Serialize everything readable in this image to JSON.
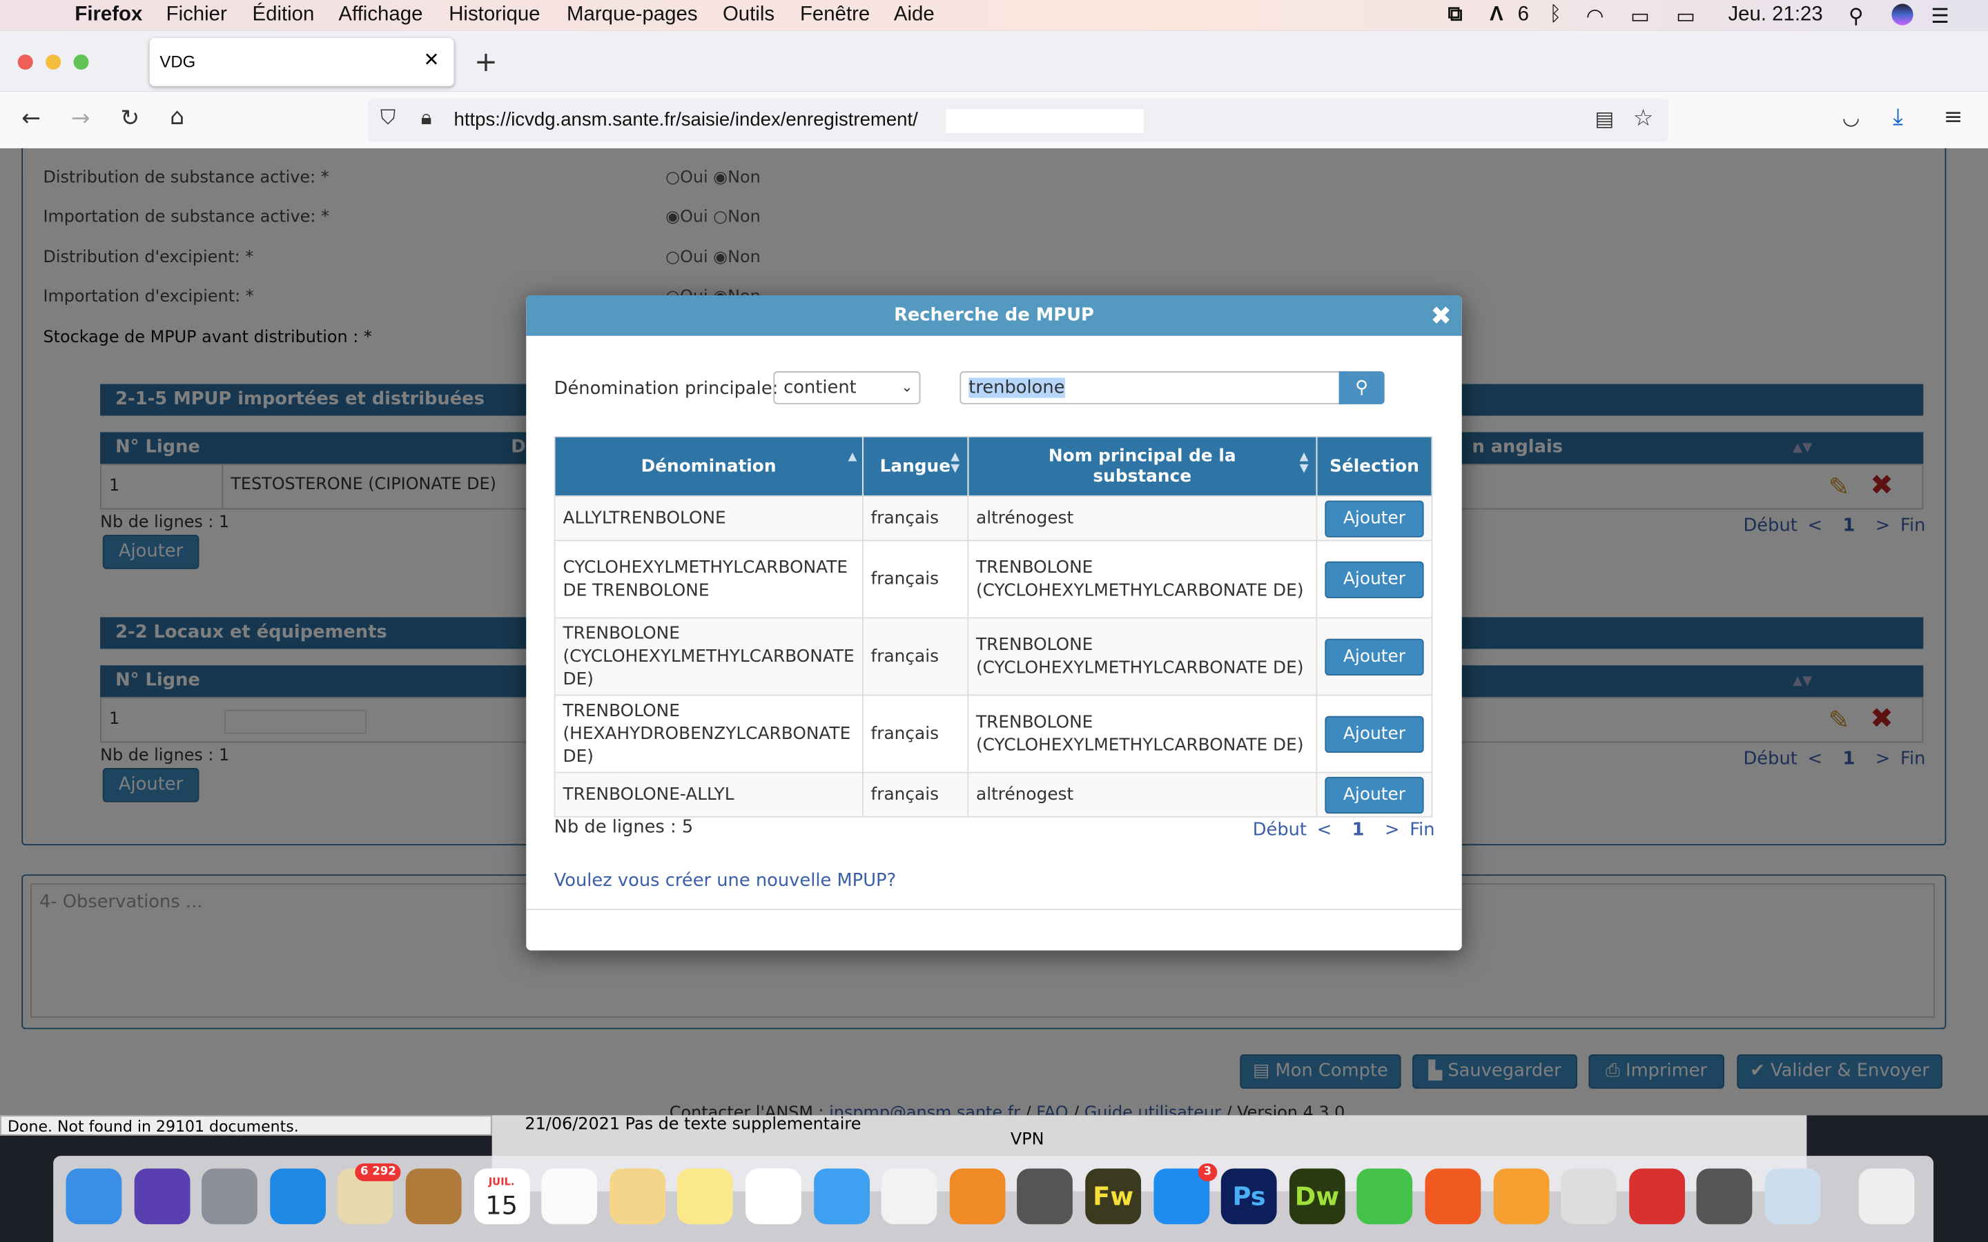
{
  "menubar": {
    "app": "Firefox",
    "items": [
      "Fichier",
      "Édition",
      "Affichage",
      "Historique",
      "Marque-pages",
      "Outils",
      "Fenêtre",
      "Aide"
    ],
    "adobe_count": "6",
    "clock": "Jeu. 21:23"
  },
  "browser": {
    "tab_title": "VDG",
    "url": "https://icvdg.ansm.sante.fr/saisie/index/enregistrement/"
  },
  "form": {
    "fields": [
      {
        "label": "Distribution de substance active: *",
        "selected": "Non"
      },
      {
        "label": "Importation de substance active: *",
        "selected": "Oui"
      },
      {
        "label": "Distribution d'excipient: *",
        "selected": "Non"
      },
      {
        "label": "Importation d'excipient: *",
        "selected": "Non"
      },
      {
        "label": "Stockage de MPUP avant distribution : *",
        "selected": ""
      }
    ],
    "radio_oui": "Oui",
    "radio_non": "Non",
    "section1": {
      "title": "2-1-5 MPUP importées et distribuées",
      "col1": "N° Ligne",
      "col2": "D",
      "col_right": "n anglais",
      "row": {
        "num": "1",
        "name": "TESTOSTERONE (CIPIONATE DE)"
      },
      "count": "Nb de lignes : 1",
      "add": "Ajouter"
    },
    "section2": {
      "title": "2-2 Locaux et équipements",
      "col1": "N° Ligne",
      "row": {
        "num": "1"
      },
      "count": "Nb de lignes : 1",
      "add": "Ajouter"
    },
    "pagination": {
      "first": "Début",
      "prev": "<",
      "page": "1",
      "next": ">",
      "last": "Fin"
    },
    "observations_placeholder": "4- Observations ...",
    "buttons": {
      "account": "Mon Compte",
      "save": "Sauvegarder",
      "print": "Imprimer",
      "submit": "Valider & Envoyer"
    },
    "footer": {
      "contact": "Contacter l'ANSM : ",
      "email": "inspmp@ansm.sante.fr",
      "faq": "FAQ",
      "guide": "Guide utilisateur",
      "version": "/ Version 4.3.0",
      "sep": " / "
    }
  },
  "modal": {
    "title": "Recherche de MPUP",
    "search_label": "Dénomination principale:",
    "operator": "contient",
    "query": "trenbolone",
    "columns": [
      "Dénomination",
      "Langue",
      "Nom principal de la substance",
      "Sélection"
    ],
    "rows": [
      {
        "denomination": "ALLYLTRENBOLONE",
        "langue": "français",
        "substance": "altrénogest",
        "action": "Ajouter"
      },
      {
        "denomination": "CYCLOHEXYLMETHYLCARBONATE DE TRENBOLONE",
        "langue": "français",
        "substance": "TRENBOLONE (CYCLOHEXYLMETHYLCARBONATE DE)",
        "action": "Ajouter"
      },
      {
        "denomination": "TRENBOLONE (CYCLOHEXYLMETHYLCARBONATE DE)",
        "langue": "français",
        "substance": "TRENBOLONE (CYCLOHEXYLMETHYLCARBONATE DE)",
        "action": "Ajouter"
      },
      {
        "denomination": "TRENBOLONE (HEXAHYDROBENZYLCARBONATE DE)",
        "langue": "français",
        "substance": "TRENBOLONE (CYCLOHEXYLMETHYLCARBONATE DE)",
        "action": "Ajouter"
      },
      {
        "denomination": "TRENBOLONE-ALLYL",
        "langue": "français",
        "substance": "altrénogest",
        "action": "Ajouter"
      }
    ],
    "count": "Nb de lignes : 5",
    "create_link": "Voulez vous créer une nouvelle MPUP?"
  },
  "statusbar": "Done. Not found in 29101 documents.",
  "background_window": {
    "date": "21/06/2021",
    "text": "Pas de texte supplementaire",
    "vpn": "VPN"
  },
  "dock": {
    "apps": [
      "Finder",
      "Siri",
      "Launchpad",
      "Safari",
      "Mail",
      "Contacts",
      "Calendrier",
      "Rappels",
      "Aperçu",
      "Notes",
      "Photos",
      "Messages",
      "Musique",
      "Livres",
      "Préférences Système",
      "Fireworks",
      "App Store",
      "Photoshop",
      "Dreamweaver",
      "FaceTime",
      "Firefox",
      "Pages",
      "Imprimante",
      "Expensify",
      "Calculette",
      "Aperçu photo",
      "Corbeille"
    ],
    "mail_badge": "6 292",
    "appstore_badge": "3",
    "calendar_month": "JUIL.",
    "calendar_day": "15"
  },
  "colors": {
    "modal_header": "#5499c0",
    "table_header": "#2e75a6",
    "button": "#3d8ac0",
    "link": "#3a5ea8"
  }
}
